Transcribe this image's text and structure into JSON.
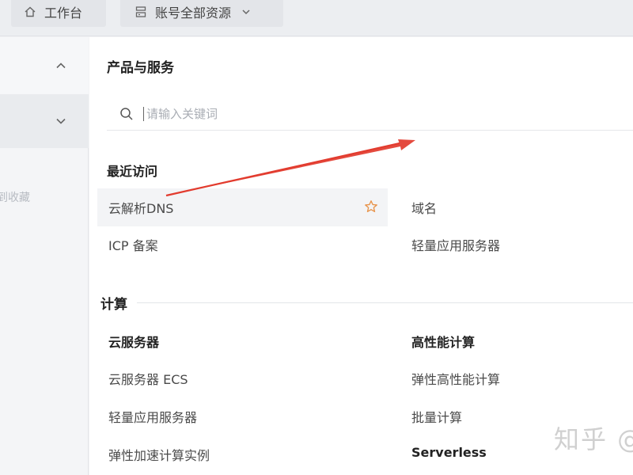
{
  "topbar": {
    "workbench_label": "工作台",
    "resources_label": "账号全部资源"
  },
  "sidebar": {
    "hint": "到收藏"
  },
  "panel": {
    "title": "产品与服务",
    "search": {
      "placeholder": "请输入关键词"
    },
    "recent": {
      "title": "最近访问",
      "items": [
        "云解析DNS",
        "域名",
        "ICP 备案",
        "轻量应用服务器"
      ]
    },
    "compute": {
      "title": "计算",
      "groups": [
        {
          "title": "云服务器",
          "links": [
            "云服务器 ECS",
            "轻量应用服务器",
            "弹性加速计算实例"
          ]
        },
        {
          "title": "高性能计算",
          "links": [
            "弹性高性能计算",
            "批量计算"
          ],
          "next_title": "Serverless"
        }
      ]
    }
  },
  "colors": {
    "accent_star": "#e8934a",
    "annotation_arrow": "#e23b2e"
  },
  "watermark": "知乎 @"
}
